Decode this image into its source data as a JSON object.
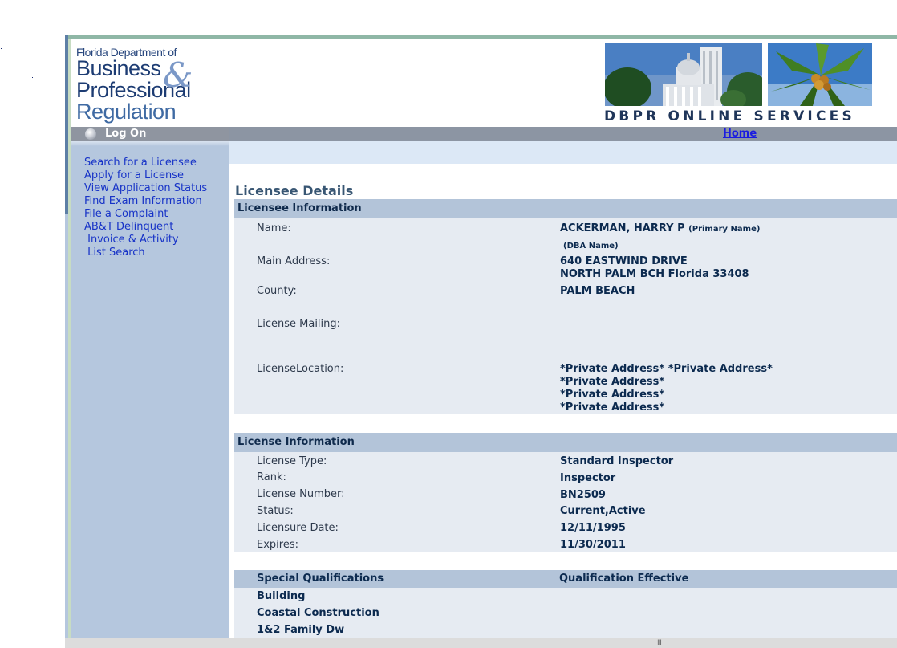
{
  "header": {
    "logo": {
      "line1": "Florida Department of",
      "line2": "Business",
      "line3": "Professional",
      "line4": "Regulation",
      "ampersand": "&"
    },
    "services_text": "DBPR ONLINE SERVICES"
  },
  "nav": {
    "logon_label": "Log On",
    "home_label": "Home"
  },
  "sidebar": {
    "items": [
      {
        "label": "Search for a Licensee"
      },
      {
        "label": "Apply for a License"
      },
      {
        "label": "View Application Status"
      },
      {
        "label": "Find Exam Information"
      },
      {
        "label": "File a Complaint"
      },
      {
        "label": "AB&T Delinquent"
      },
      {
        "label": " Invoice & Activity"
      },
      {
        "label": " List Search"
      }
    ]
  },
  "page": {
    "title": "Licensee Details"
  },
  "licensee_info": {
    "heading": "Licensee Information",
    "name_label": "Name:",
    "name_value": "ACKERMAN, HARRY P",
    "primary_name_tag": "(Primary Name)",
    "dba_tag": "(DBA Name)",
    "main_address_label": "Main Address:",
    "main_address_line1": "640 EASTWIND DRIVE",
    "main_address_line2": "NORTH PALM BCH  Florida  33408",
    "county_label": "County:",
    "county_value": "PALM BEACH",
    "mailing_label": "License Mailing:",
    "location_label": "LicenseLocation:",
    "location_lines": [
      "*Private Address* *Private Address*",
      "*Private Address*",
      "*Private Address*",
      "*Private Address*"
    ]
  },
  "license_info": {
    "heading": "License Information",
    "rows": [
      {
        "label": "License Type:",
        "value": "Standard Inspector"
      },
      {
        "label": "Rank:",
        "value": "Inspector"
      },
      {
        "label": "License Number:",
        "value": "BN2509"
      },
      {
        "label": "Status:",
        "value": "Current,Active"
      },
      {
        "label": "Licensure Date:",
        "value": "12/11/1995"
      },
      {
        "label": "Expires:",
        "value": "11/30/2011"
      }
    ]
  },
  "qualifications": {
    "header_left": "Special Qualifications",
    "header_right": "Qualification Effective",
    "items": [
      "Building",
      "Coastal Construction",
      "1&2 Family Dw"
    ]
  },
  "scrollbar": {
    "grip": "III"
  },
  "colors": {
    "link": "#1733c7",
    "section_header": "#b3c4d9",
    "panel": "#e6ebf2",
    "sidebar": "#b5c7de",
    "navbar": "#8c95a3",
    "accent_green": "#8fb7a6"
  }
}
